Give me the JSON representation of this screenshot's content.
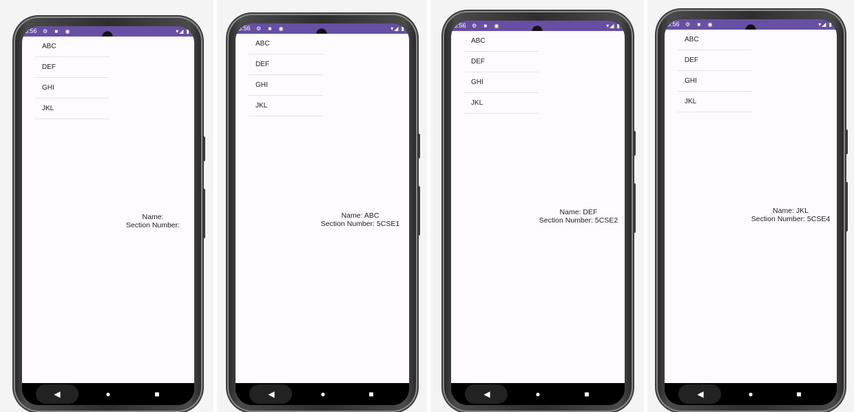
{
  "status_bar": {
    "time": "3:56",
    "icons": "⚙ ■ ◉",
    "right_icons": "▾◢ ▮"
  },
  "list_items": [
    "ABC",
    "DEF",
    "GHI",
    "JKL"
  ],
  "screens": [
    {
      "name_line": "Name:",
      "section_line": "Section Number:"
    },
    {
      "name_line": "Name: ABC",
      "section_line": "Section Number: 5CSE1"
    },
    {
      "name_line": "Name: DEF",
      "section_line": "Section Number: 5CSE2"
    },
    {
      "name_line": "Name: JKL",
      "section_line": "Section Number: 5CSE4"
    }
  ],
  "nav": {
    "back": "◀",
    "home": "●",
    "recents": "■"
  },
  "colors": {
    "status_bar": "#6750a4",
    "app_background": "#fffbfe",
    "nav_bar": "#000000"
  }
}
